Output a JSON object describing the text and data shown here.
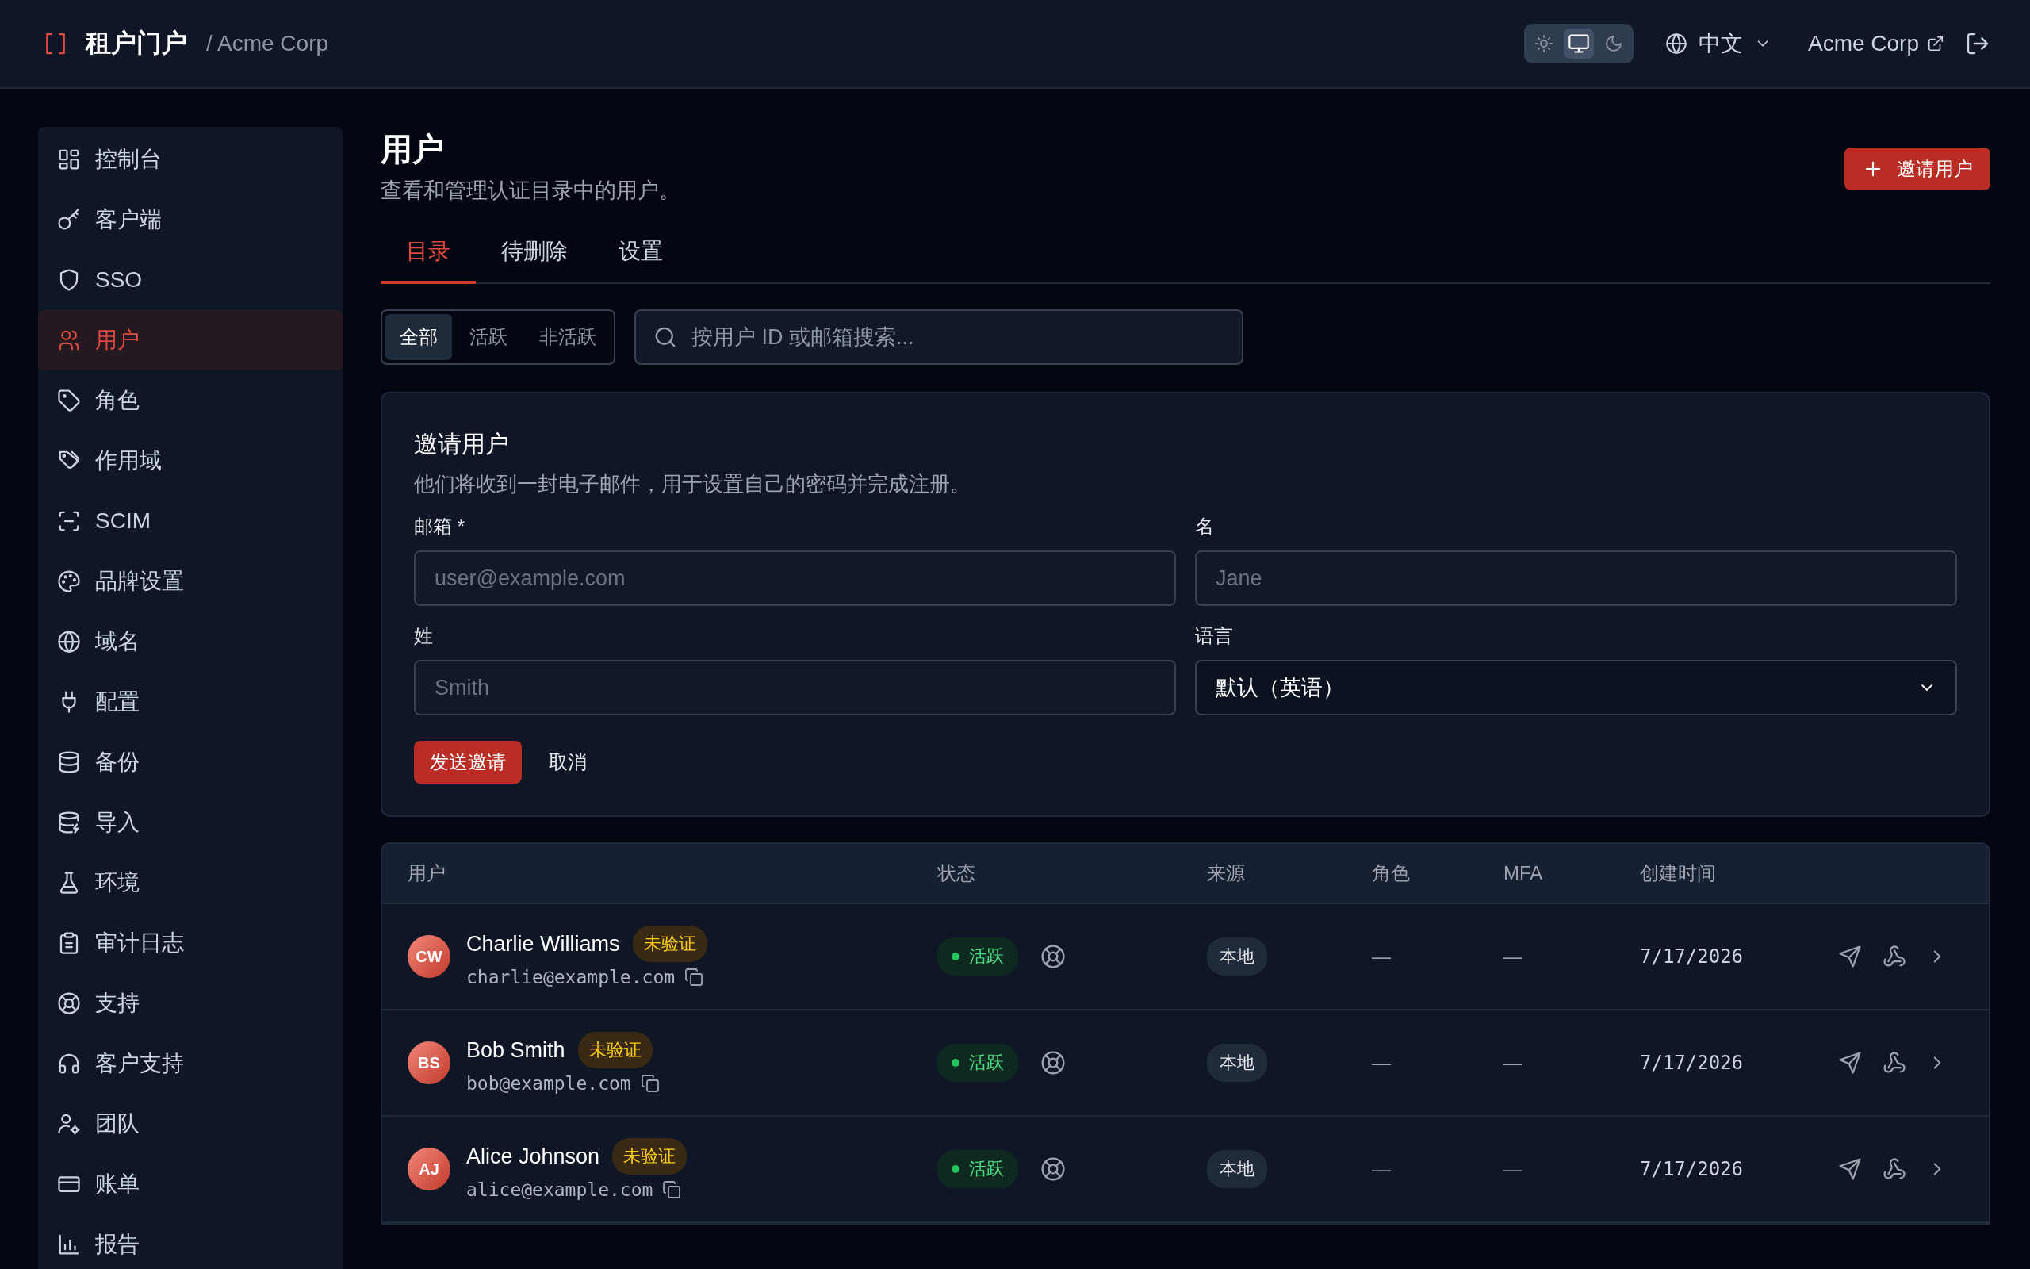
{
  "header": {
    "brand": "租户门户",
    "tenant": "/ Acme Corp",
    "theme_modes": [
      {
        "kind": "light",
        "selected": false
      },
      {
        "kind": "system",
        "selected": true
      },
      {
        "kind": "dark",
        "selected": false
      }
    ],
    "language": "中文",
    "account": "Acme Corp"
  },
  "sidebar": {
    "items": [
      {
        "label": "控制台",
        "kind": "dashboard",
        "selected": false
      },
      {
        "label": "客户端",
        "kind": "key",
        "selected": false
      },
      {
        "label": "SSO",
        "kind": "shield",
        "selected": false
      },
      {
        "label": "用户",
        "kind": "users",
        "selected": true
      },
      {
        "label": "角色",
        "kind": "tag",
        "selected": false
      },
      {
        "label": "作用域",
        "kind": "tags",
        "selected": false
      },
      {
        "label": "SCIM",
        "kind": "scan",
        "selected": false
      },
      {
        "label": "品牌设置",
        "kind": "palette",
        "selected": false
      },
      {
        "label": "域名",
        "kind": "globe",
        "selected": false
      },
      {
        "label": "配置",
        "kind": "plug",
        "selected": false
      },
      {
        "label": "备份",
        "kind": "database",
        "selected": false
      },
      {
        "label": "导入",
        "kind": "database-zap",
        "selected": false
      },
      {
        "label": "环境",
        "kind": "flask",
        "selected": false
      },
      {
        "label": "审计日志",
        "kind": "clipboard",
        "selected": false
      },
      {
        "label": "支持",
        "kind": "lifebuoy",
        "selected": false
      },
      {
        "label": "客户支持",
        "kind": "headphones",
        "selected": false
      },
      {
        "label": "团队",
        "kind": "user-cog",
        "selected": false
      },
      {
        "label": "账单",
        "kind": "card",
        "selected": false
      },
      {
        "label": "报告",
        "kind": "chart",
        "selected": false
      }
    ]
  },
  "page": {
    "title": "用户",
    "subtitle": "查看和管理认证目录中的用户。",
    "invite_button": "邀请用户"
  },
  "tabs": [
    {
      "label": "目录",
      "selected": true
    },
    {
      "label": "待删除",
      "selected": false
    },
    {
      "label": "设置",
      "selected": false
    }
  ],
  "filter": [
    {
      "label": "全部",
      "selected": true
    },
    {
      "label": "活跃",
      "selected": false
    },
    {
      "label": "非活跃",
      "selected": false
    }
  ],
  "search": {
    "placeholder": "按用户 ID 或邮箱搜索..."
  },
  "invite_form": {
    "title": "邀请用户",
    "description": "他们将收到一封电子邮件，用于设置自己的密码并完成注册。",
    "fields": [
      {
        "kind": "input",
        "label": "邮箱 *",
        "placeholder": "user@example.com"
      },
      {
        "kind": "input",
        "label": "名",
        "placeholder": "Jane"
      },
      {
        "kind": "input",
        "label": "姓",
        "placeholder": "Smith"
      },
      {
        "kind": "select",
        "label": "语言",
        "value": "默认（英语）"
      }
    ],
    "submit": "发送邀请",
    "cancel": "取消"
  },
  "table": {
    "columns": [
      "用户",
      "状态",
      "来源",
      "角色",
      "MFA",
      "创建时间"
    ],
    "rows": [
      {
        "initials": "CW",
        "name": "Charlie Williams",
        "badge": "未验证",
        "email": "charlie@example.com",
        "status": "活跃",
        "source": "本地",
        "role": "—",
        "mfa": "—",
        "created": "7/17/2026"
      },
      {
        "initials": "BS",
        "name": "Bob Smith",
        "badge": "未验证",
        "email": "bob@example.com",
        "status": "活跃",
        "source": "本地",
        "role": "—",
        "mfa": "—",
        "created": "7/17/2026"
      },
      {
        "initials": "AJ",
        "name": "Alice Johnson",
        "badge": "未验证",
        "email": "alice@example.com",
        "status": "活跃",
        "source": "本地",
        "role": "—",
        "mfa": "—",
        "created": "7/17/2026"
      }
    ]
  }
}
